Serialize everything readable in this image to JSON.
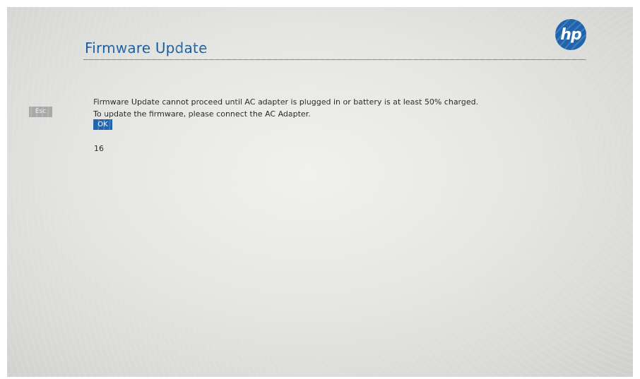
{
  "header": {
    "title": "Firmware Update",
    "logo_text": "hp",
    "logo_color": "#1f64ad",
    "title_color": "#1a5c9c"
  },
  "sidebar": {
    "esc_label": "Esc"
  },
  "dialog": {
    "message_line1": "Firmware Update cannot proceed until AC adapter is plugged in or battery is at least 50% charged.",
    "message_line2": "To update the firmware, please connect the AC Adapter.",
    "ok_label": "OK",
    "countdown": "16"
  }
}
